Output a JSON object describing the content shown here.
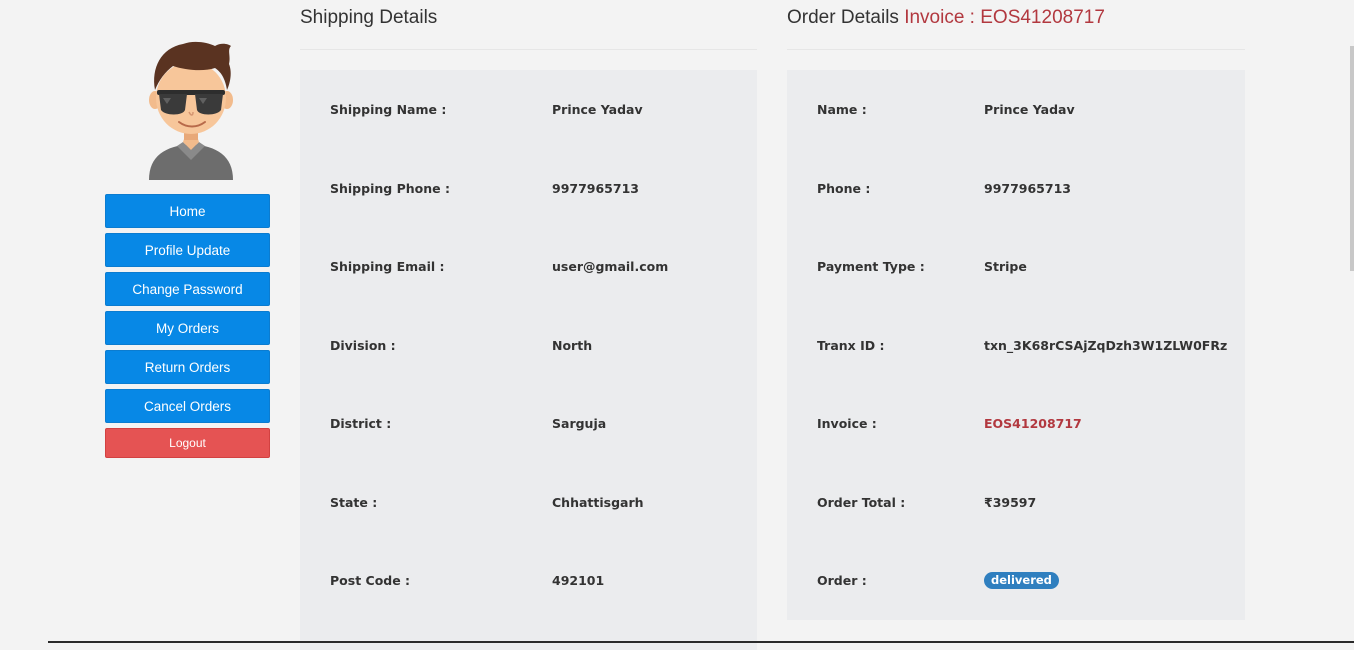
{
  "sidebar": {
    "nav": [
      {
        "label": "Home"
      },
      {
        "label": "Profile Update"
      },
      {
        "label": "Change Password"
      },
      {
        "label": "My Orders"
      },
      {
        "label": "Return Orders"
      },
      {
        "label": "Cancel Orders"
      }
    ],
    "logout_label": "Logout"
  },
  "shipping": {
    "title": "Shipping Details",
    "rows": [
      {
        "label": "Shipping Name :",
        "value": "Prince Yadav"
      },
      {
        "label": "Shipping Phone :",
        "value": "9977965713"
      },
      {
        "label": "Shipping Email :",
        "value": "user@gmail.com"
      },
      {
        "label": "Division :",
        "value": "North"
      },
      {
        "label": "District :",
        "value": "Sarguja"
      },
      {
        "label": "State :",
        "value": "Chhattisgarh"
      },
      {
        "label": "Post Code :",
        "value": "492101"
      }
    ]
  },
  "order": {
    "title": "Order Details",
    "title_invoice": "Invoice : EOS41208717",
    "rows": [
      {
        "label": "Name :",
        "value": "Prince Yadav"
      },
      {
        "label": "Phone :",
        "value": "9977965713"
      },
      {
        "label": "Payment Type :",
        "value": "Stripe"
      },
      {
        "label": "Tranx ID :",
        "value": "txn_3K68rCSAjZqDzh3W1ZLW0FRz"
      },
      {
        "label": "Invoice :",
        "value": "EOS41208717"
      },
      {
        "label": "Order Total :",
        "value": "₹39597"
      },
      {
        "label": "Order :",
        "value": "delivered"
      }
    ]
  },
  "colors": {
    "nav_button": "#0788e6",
    "logout_button": "#e55353",
    "invoice_accent": "#b2383f",
    "status_badge": "#2f7fbf",
    "panel_bg": "#ebecee"
  },
  "icons": {
    "avatar": "cartoon-man-with-sunglasses"
  }
}
